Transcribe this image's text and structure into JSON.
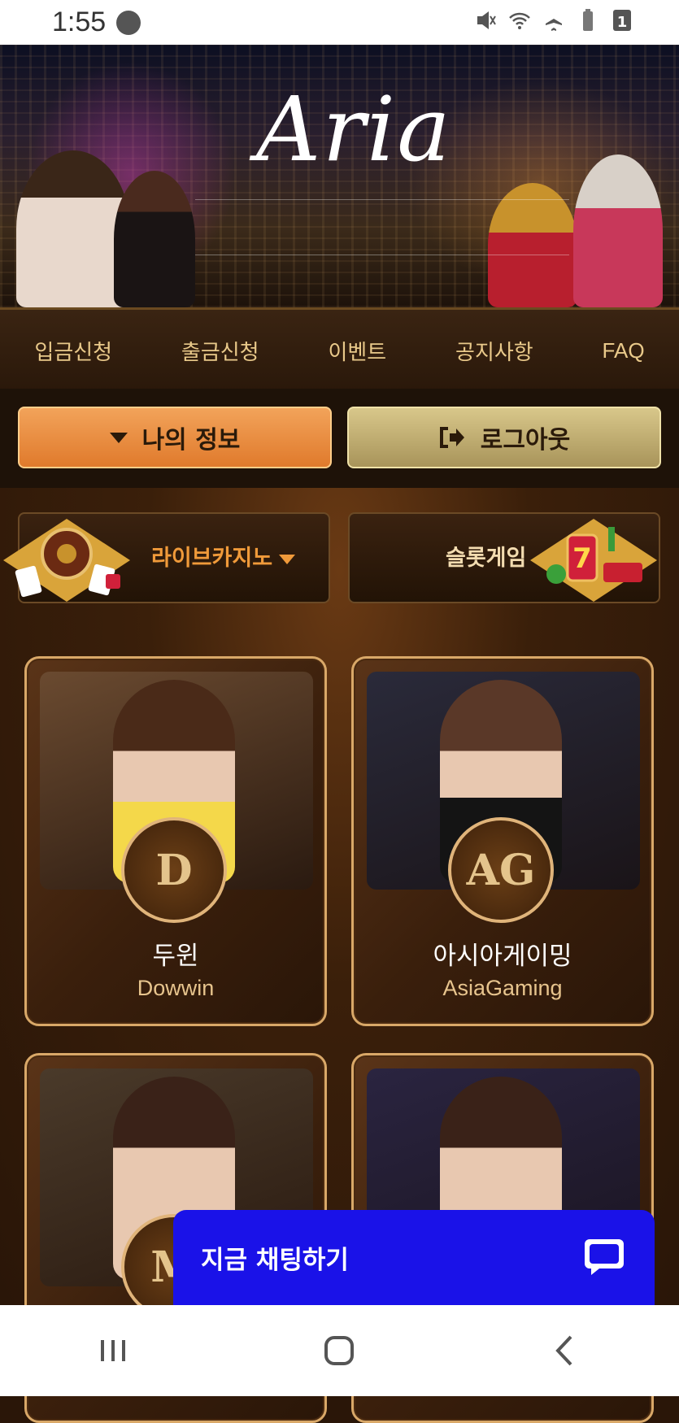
{
  "status": {
    "time": "1:55",
    "battery_level": "1"
  },
  "hero": {
    "logo": "Aria",
    "slides": 3,
    "active_slide": 1
  },
  "nav": {
    "items": [
      {
        "label": "입금신청"
      },
      {
        "label": "출금신청"
      },
      {
        "label": "이벤트"
      },
      {
        "label": "공지사항"
      },
      {
        "label": "FAQ"
      }
    ]
  },
  "actions": {
    "my_info": "나의 정보",
    "logout": "로그아웃"
  },
  "categories": {
    "live_casino": "라이브카지노",
    "slot_games": "슬롯게임"
  },
  "providers": [
    {
      "title": "두윈",
      "subtitle": "Dowwin",
      "badge": "D"
    },
    {
      "title": "아시아게이밍",
      "subtitle": "AsiaGaming",
      "badge": "AG"
    },
    {
      "badge": "M"
    },
    {}
  ],
  "chat": {
    "label": "지금 채팅하기"
  },
  "colors": {
    "accent_orange": "#e07a2c",
    "chat_blue": "#1a12e8",
    "gold": "#e7c48d"
  }
}
